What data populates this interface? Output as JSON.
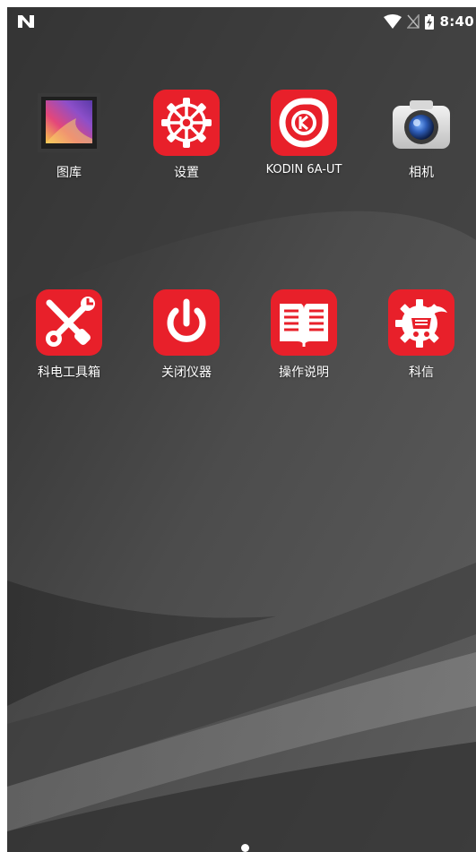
{
  "status_bar": {
    "time": "8:40",
    "icons": [
      "notification-n-icon",
      "wifi-icon",
      "no-sim-icon",
      "battery-charging-icon"
    ]
  },
  "apps_row1": [
    {
      "label": "图库",
      "icon": "gallery-icon"
    },
    {
      "label": "设置",
      "icon": "settings-gear-icon"
    },
    {
      "label": "KODIN 6A-UT",
      "icon": "kodin-logo-icon"
    },
    {
      "label": "相机",
      "icon": "camera-icon"
    }
  ],
  "apps_row2": [
    {
      "label": "科电工具箱",
      "icon": "toolbox-wrench-screwdriver-icon"
    },
    {
      "label": "关闭仪器",
      "icon": "power-icon"
    },
    {
      "label": "操作说明",
      "icon": "manual-book-icon"
    },
    {
      "label": "科信",
      "icon": "kexin-gear-icon"
    }
  ],
  "colors": {
    "app_red": "#e8202a",
    "label_text": "#ffffff"
  },
  "page_indicator": {
    "pages": 1,
    "current": 1
  }
}
